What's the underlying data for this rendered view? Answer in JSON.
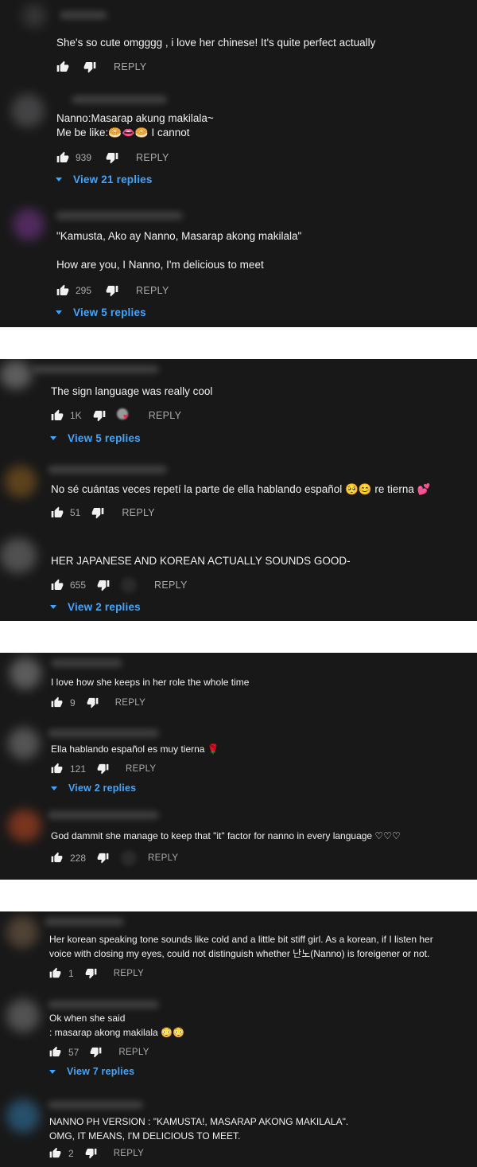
{
  "panels": [
    {
      "comments": [
        {
          "text": "She's so cute omgggg , i love her chinese! It's quite perfect actually",
          "likes": "",
          "reply_label": "REPLY"
        },
        {
          "text": "Nanno:Masarap akung makilala~\nMe be like:🥯👄🥯 I cannot",
          "likes": "939",
          "reply_label": "REPLY",
          "view_replies": "View 21 replies"
        },
        {
          "text": "\"Kamusta, Ako ay Nanno, Masarap akong makilala\"\n\nHow are you, I Nanno, I'm delicious to meet",
          "likes": "295",
          "reply_label": "REPLY",
          "view_replies": "View 5 replies"
        }
      ]
    },
    {
      "comments": [
        {
          "text": "The sign language was really cool",
          "likes": "1K",
          "reply_label": "REPLY",
          "view_replies": "View 5 replies"
        },
        {
          "text": "No sé cuántas veces repetí la parte de ella hablando español 🥺😊 re tierna 💕",
          "likes": "51",
          "reply_label": "REPLY"
        },
        {
          "text": "HER JAPANESE AND KOREAN ACTUALLY SOUNDS GOOD-",
          "likes": "655",
          "reply_label": "REPLY",
          "view_replies": "View 2 replies"
        }
      ]
    },
    {
      "comments": [
        {
          "text": "I love how she keeps in her role the whole time",
          "likes": "9",
          "reply_label": "REPLY"
        },
        {
          "text": "Ella hablando español es muy tierna 🌹",
          "likes": "121",
          "reply_label": "REPLY",
          "view_replies": "View 2 replies"
        },
        {
          "text": "God dammit she manage to keep that \"it\" factor for nanno in every language ♡♡♡",
          "likes": "228",
          "reply_label": "REPLY"
        }
      ]
    },
    {
      "comments": [
        {
          "text": "Her korean speaking tone sounds like cold and a little bit stiff girl. As a korean, if I listen her\nvoice with closing my eyes, could not distinguish whether 난노(Nanno) is foreigener or not.",
          "likes": "1",
          "reply_label": "REPLY"
        },
        {
          "text": "Ok when she said\n: masarap akong makilala 😳😳",
          "likes": "57",
          "reply_label": "REPLY",
          "view_replies": "View 7 replies"
        },
        {
          "text": "NANNO PH VERSION : \"KAMUSTA!, MASARAP AKONG MAKILALA\".\nOMG, IT MEANS, I'M DELICIOUS TO MEET.",
          "likes": "2",
          "reply_label": "REPLY"
        }
      ]
    }
  ],
  "colors": {
    "background": "#181818",
    "text": "#f1f1f1",
    "secondary_text": "#aaaaaa",
    "link": "#3ea6ff"
  },
  "icons": [
    "thumb-up-icon",
    "thumb-down-icon",
    "expand-caret-icon",
    "creator-heart-icon"
  ]
}
